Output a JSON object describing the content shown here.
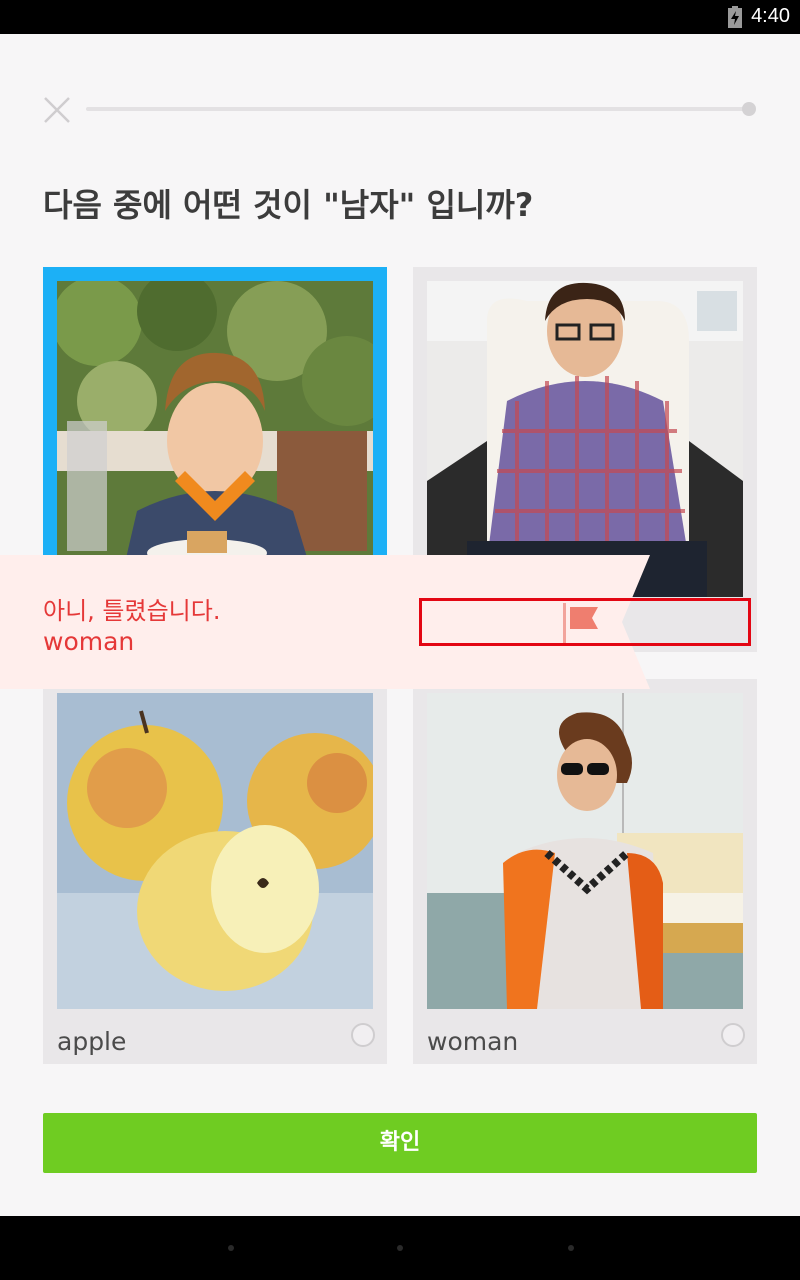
{
  "status_bar": {
    "time": "4:40",
    "battery_icon": "battery-charging-icon"
  },
  "header": {
    "close_icon": "close-icon",
    "progress": 0
  },
  "question": "다음 중에 어떤 것이 \"남자\" 입니까?",
  "choices": [
    {
      "label": "",
      "selected": true,
      "image": "boy-photo"
    },
    {
      "label": "",
      "selected": false,
      "image": "man-photo"
    },
    {
      "label": "apple",
      "selected": false,
      "image": "apple-photo"
    },
    {
      "label": "woman",
      "selected": false,
      "image": "woman-photo"
    }
  ],
  "feedback": {
    "message": "아니, 틀렸습니다.",
    "correct_answer": "woman",
    "flag_icon": "flag-icon"
  },
  "check_button": "확인",
  "colors": {
    "selected": "#1cb0f6",
    "button": "#6fcc22",
    "error_text": "#e53838",
    "feedback_bg": "#ffeeec",
    "highlight": "#e30613"
  }
}
